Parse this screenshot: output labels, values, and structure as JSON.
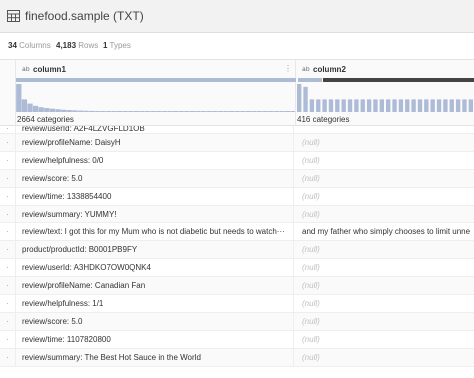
{
  "dataset": {
    "title": "finefood.sample (TXT)",
    "icon": "dataset-table-icon"
  },
  "meta": {
    "columns_count": "34",
    "columns_label": "Columns",
    "rows_count": "4,183",
    "rows_label": "Rows",
    "types_count": "1",
    "types_label": "Types"
  },
  "columns": [
    {
      "type_badge": "ab",
      "name": "column1",
      "categories": "2664 categories",
      "menu_icon": "more-vertical-icon",
      "histogram": [
        1,
        0.45,
        0.3,
        0.22,
        0.17,
        0.14,
        0.12,
        0.1,
        0.08,
        0.07,
        0.06,
        0.05,
        0.045,
        0.04,
        0.035,
        0.03,
        0.03,
        0.03,
        0.03,
        0.03,
        0.03,
        0.03,
        0.03,
        0.03,
        0.03,
        0.03,
        0.03,
        0.03,
        0.03,
        0.03,
        0.03,
        0.03,
        0.03,
        0.03,
        0.03,
        0.03,
        0.03,
        0.03,
        0.03,
        0.03,
        0.03,
        0.03,
        0.03,
        0.03,
        0.03,
        0.03,
        0.03,
        0.03,
        0.03,
        0.03
      ]
    },
    {
      "type_badge": "ab",
      "name": "column2",
      "categories": "416 categories",
      "histogram": [
        1,
        0.9,
        0.45,
        0.45,
        0.45,
        0.45,
        0.45,
        0.45,
        0.45,
        0.45,
        0.45,
        0.45,
        0.45,
        0.45,
        0.45,
        0.45,
        0.45,
        0.45,
        0.45,
        0.45,
        0.45,
        0.45,
        0.45,
        0.45,
        0.45,
        0.45,
        0.45,
        0.45
      ]
    }
  ],
  "rows": [
    {
      "c1": "review/userId:  A2F4LZVGFLD1OB",
      "c2": ""
    },
    {
      "c1": "review/profileName:  DaisyH",
      "c2": "(null)"
    },
    {
      "c1": "review/helpfulness:  0/0",
      "c2": "(null)"
    },
    {
      "c1": "review/score:  5.0",
      "c2": "(null)"
    },
    {
      "c1": "review/time:  1338854400",
      "c2": "(null)"
    },
    {
      "c1": "review/summary:  YUMMY!",
      "c2": "(null)"
    },
    {
      "c1": "review/text:  I  got  this  for  my  Mum  who  is  not  diabetic  but  needs  to  watch···",
      "c2": "and  my  father  who  simply  chooses  to  limit  unne"
    },
    {
      "c1": "product/productId:  B0001PB9FY",
      "c2": "(null)"
    },
    {
      "c1": "review/userId:  A3HDKO7OW0QNK4",
      "c2": "(null)"
    },
    {
      "c1": "review/profileName:  Canadian  Fan",
      "c2": "(null)"
    },
    {
      "c1": "review/helpfulness:  1/1",
      "c2": "(null)"
    },
    {
      "c1": "review/score:  5.0",
      "c2": "(null)"
    },
    {
      "c1": "review/time:  1107820800",
      "c2": "(null)"
    },
    {
      "c1": "review/summary:  The  Best  Hot  Sauce  in  the  World",
      "c2": "(null)"
    }
  ],
  "row_marker": "·"
}
